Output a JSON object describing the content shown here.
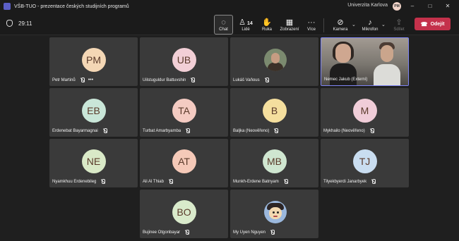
{
  "window": {
    "title": "VŠB-TUO - prezentace českých studijních programů",
    "org": "Univerzita Karlova",
    "org_initials": "PM"
  },
  "toolbar": {
    "timer": "29:11",
    "chat": "Chat",
    "people": "Lidé",
    "people_count": "14",
    "raise": "Ruka",
    "view": "Zobrazení",
    "more": "Více",
    "camera": "Kamera",
    "mic": "Mikrofon",
    "share": "Sdílet",
    "leave": "Odejít"
  },
  "icons": [
    "shield-icon",
    "chat-icon",
    "people-icon",
    "hand-icon",
    "grid-icon",
    "more-icon",
    "camera-off-icon",
    "mic-off-icon",
    "share-icon",
    "phone-icon"
  ],
  "participants": [
    {
      "name": "Petr Martinů",
      "initials": "PM",
      "color": "#f4d7b5",
      "more": "•••"
    },
    {
      "name": "Uilstuguldur Battuvshin",
      "initials": "UB",
      "color": "#f2cfd6"
    },
    {
      "name": "Lukáš Vaňous"
    },
    {
      "name": "Nemec Jakub (Externí)"
    },
    {
      "name": "Erdenebat Bayarmagnai",
      "initials": "EB",
      "color": "#c9e6d8"
    },
    {
      "name": "Turbat Amarbyamba",
      "initials": "TA",
      "color": "#f4cbc2"
    },
    {
      "name": "Baljka (Neověřeno)",
      "initials": "B",
      "color": "#f5df9e"
    },
    {
      "name": "Mykhailo (Neověřeno)",
      "initials": "M",
      "color": "#f0cdd8"
    },
    {
      "name": "Nyamkhuu Erdenebileg",
      "initials": "NE",
      "color": "#d9e9c7"
    },
    {
      "name": "Ali Al Thiab",
      "initials": "AT",
      "color": "#f5c9b8"
    },
    {
      "name": "Munkh-Erdene Batnyam",
      "initials": "MB",
      "color": "#cfe6d0"
    },
    {
      "name": "Tilyekbyerdi Janarbyek",
      "initials": "TJ",
      "color": "#c9ddf0"
    },
    {
      "name": "Bujinee Otgonbayar",
      "initials": "BO",
      "color": "#d9eacb"
    },
    {
      "name": "My Uyen Nguyen"
    }
  ],
  "colors": {
    "accent": "#7f85f5",
    "leave": "#c4314b",
    "background": "#1f1f1f"
  }
}
